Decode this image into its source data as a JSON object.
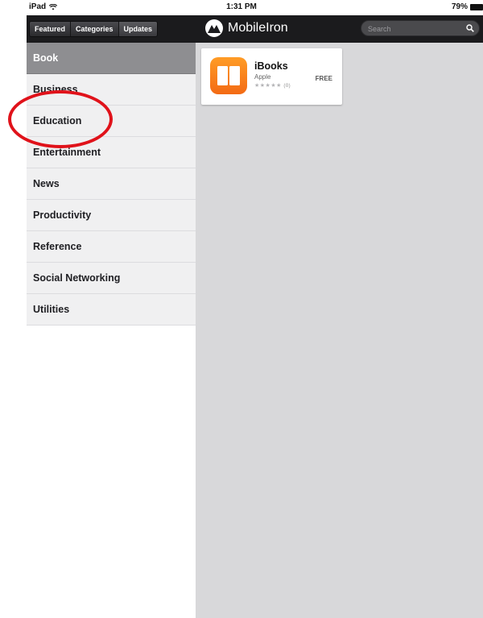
{
  "status_bar": {
    "device": "iPad",
    "wifi_icon": "wifi-icon",
    "time": "1:31 PM",
    "battery_percent": "79%",
    "battery_level": 0.79
  },
  "navbar": {
    "tabs": [
      {
        "label": "Featured"
      },
      {
        "label": "Categories"
      },
      {
        "label": "Updates"
      }
    ],
    "brand": "MobileIron",
    "search_placeholder": "Search"
  },
  "sidebar": {
    "categories": [
      {
        "label": "Book",
        "selected": true
      },
      {
        "label": "Business"
      },
      {
        "label": "Education"
      },
      {
        "label": "Entertainment"
      },
      {
        "label": "News"
      },
      {
        "label": "Productivity"
      },
      {
        "label": "Reference"
      },
      {
        "label": "Social Networking"
      },
      {
        "label": "Utilities"
      }
    ]
  },
  "apps": [
    {
      "name": "iBooks",
      "developer": "Apple",
      "price": "FREE",
      "stars": "★★★★★",
      "rating": 0,
      "rating_count": "(0)",
      "icon": "book-icon"
    }
  ],
  "colors": {
    "navbar": "#1b1b1d",
    "selected_category": "#8e8e91",
    "content_background": "#d8d8da",
    "annotation": "#e0121a",
    "app_icon": "#f57b1a"
  }
}
